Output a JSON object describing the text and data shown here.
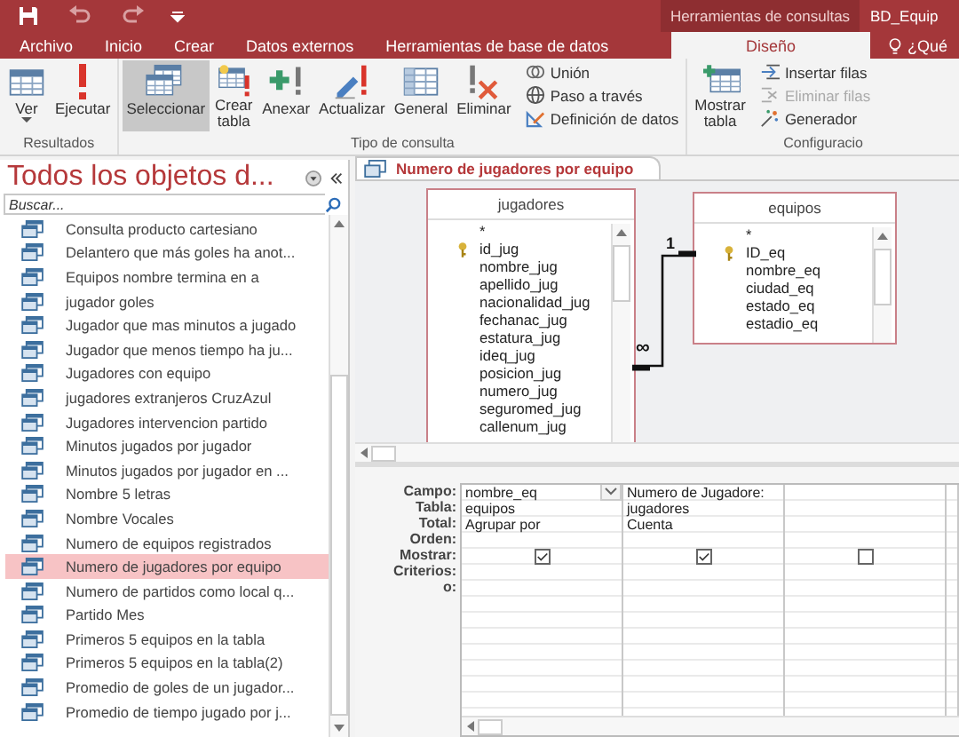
{
  "title_bar": {
    "context_tab": "Herramientas de consultas",
    "file_name": "BD_Equip"
  },
  "tabs": [
    {
      "label": "Archivo",
      "selected": false
    },
    {
      "label": "Inicio",
      "selected": false
    },
    {
      "label": "Crear",
      "selected": false
    },
    {
      "label": "Datos externos",
      "selected": false
    },
    {
      "label": "Herramientas de base de datos",
      "selected": false
    },
    {
      "label": "Diseño",
      "selected": true
    }
  ],
  "tell_me": "¿Qué",
  "ribbon": {
    "groups": [
      {
        "label": "Resultados",
        "buttons": [
          {
            "label": "Ver",
            "kind": "large",
            "menu": true
          },
          {
            "label": "Ejecutar",
            "kind": "large",
            "menu": false
          }
        ]
      },
      {
        "label": "Tipo de consulta",
        "buttons": [
          {
            "label": "Seleccionar",
            "kind": "large",
            "selected": true
          },
          {
            "label": "Crear tabla",
            "kind": "large",
            "selected": false
          },
          {
            "label": "Anexar",
            "kind": "large",
            "selected": false
          },
          {
            "label": "Actualizar",
            "kind": "large",
            "selected": false
          },
          {
            "label": "General",
            "kind": "large",
            "selected": false
          },
          {
            "label": "Eliminar",
            "kind": "large",
            "selected": false
          },
          {
            "label": "Unión",
            "kind": "small",
            "selected": false
          },
          {
            "label": "Paso a través",
            "kind": "small",
            "selected": false
          },
          {
            "label": "Definición de datos",
            "kind": "small",
            "selected": false
          }
        ]
      },
      {
        "label": "Configuracio",
        "buttons": [
          {
            "label": "Mostrar tabla",
            "kind": "large",
            "disabled": false
          },
          {
            "label": "Insertar filas",
            "kind": "small",
            "disabled": false
          },
          {
            "label": "Eliminar filas",
            "kind": "small",
            "disabled": true
          },
          {
            "label": "Generador",
            "kind": "small",
            "disabled": false
          }
        ]
      }
    ]
  },
  "nav": {
    "title": "Todos los objetos d...",
    "search": {
      "placeholder": "Buscar..."
    },
    "items": [
      {
        "label": "Consulta producto cartesiano",
        "selected": false
      },
      {
        "label": "Delantero que más goles ha anot...",
        "selected": false
      },
      {
        "label": "Equipos nombre termina en a",
        "selected": false
      },
      {
        "label": "jugador goles",
        "selected": false
      },
      {
        "label": "Jugador que mas minutos a jugado",
        "selected": false
      },
      {
        "label": "Jugador que menos tiempo ha ju...",
        "selected": false
      },
      {
        "label": "Jugadores con equipo",
        "selected": false
      },
      {
        "label": "jugadores extranjeros CruzAzul",
        "selected": false
      },
      {
        "label": "Jugadores intervencion partido",
        "selected": false
      },
      {
        "label": "Minutos jugados por jugador",
        "selected": false
      },
      {
        "label": "Minutos jugados por jugador en ...",
        "selected": false
      },
      {
        "label": "Nombre 5 letras",
        "selected": false
      },
      {
        "label": "Nombre Vocales",
        "selected": false
      },
      {
        "label": "Numero de equipos registrados",
        "selected": false
      },
      {
        "label": "Numero de jugadores por equipo",
        "selected": true
      },
      {
        "label": "Numero de partidos como local q...",
        "selected": false
      },
      {
        "label": "Partido Mes",
        "selected": false
      },
      {
        "label": "Primeros 5 equipos en la tabla",
        "selected": false
      },
      {
        "label": "Primeros 5 equipos en la tabla(2)",
        "selected": false
      },
      {
        "label": "Promedio de goles de un jugador...",
        "selected": false
      },
      {
        "label": "Promedio de tiempo jugado por j...",
        "selected": false
      }
    ]
  },
  "document_tab": {
    "label": "Numero de jugadores por equipo"
  },
  "tables": [
    {
      "name": "jugadores",
      "fields": [
        {
          "name": "*",
          "key": false
        },
        {
          "name": "id_jug",
          "key": true
        },
        {
          "name": "nombre_jug",
          "key": false
        },
        {
          "name": "apellido_jug",
          "key": false
        },
        {
          "name": "nacionalidad_jug",
          "key": false
        },
        {
          "name": "fechanac_jug",
          "key": false
        },
        {
          "name": "estatura_jug",
          "key": false
        },
        {
          "name": "ideq_jug",
          "key": false
        },
        {
          "name": "posicion_jug",
          "key": false
        },
        {
          "name": "numero_jug",
          "key": false
        },
        {
          "name": "seguromed_jug",
          "key": false
        },
        {
          "name": "callenum_jug",
          "key": false
        }
      ]
    },
    {
      "name": "equipos",
      "fields": [
        {
          "name": "*",
          "key": false
        },
        {
          "name": "ID_eq",
          "key": true
        },
        {
          "name": "nombre_eq",
          "key": false
        },
        {
          "name": "ciudad_eq",
          "key": false
        },
        {
          "name": "estado_eq",
          "key": false
        },
        {
          "name": "estadio_eq",
          "key": false
        }
      ]
    }
  ],
  "relationship": {
    "one": "1",
    "many": "∞"
  },
  "grid": {
    "row_labels": [
      "Campo:",
      "Tabla:",
      "Total:",
      "Orden:",
      "Mostrar:",
      "Criterios:",
      "o:"
    ],
    "columns": [
      {
        "field": "nombre_eq",
        "table": "equipos",
        "total": "Agrupar por",
        "show": true,
        "dropdown": true
      },
      {
        "field": "Numero de Jugadore:",
        "table": "jugadores",
        "total": "Cuenta",
        "show": true,
        "dropdown": false
      },
      {
        "show": false,
        "dropdown": false
      }
    ]
  }
}
